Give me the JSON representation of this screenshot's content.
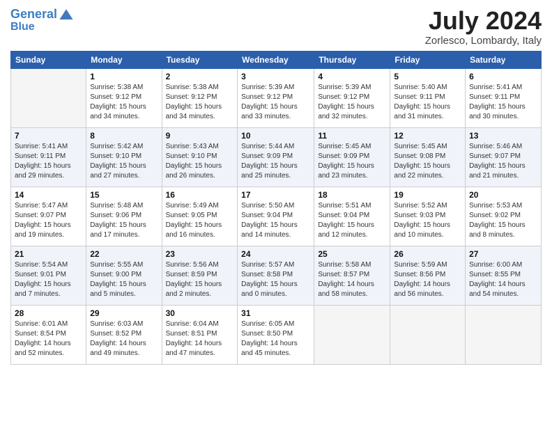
{
  "header": {
    "logo_line1": "General",
    "logo_line2": "Blue",
    "month_title": "July 2024",
    "location": "Zorlesco, Lombardy, Italy"
  },
  "weekdays": [
    "Sunday",
    "Monday",
    "Tuesday",
    "Wednesday",
    "Thursday",
    "Friday",
    "Saturday"
  ],
  "weeks": [
    [
      {
        "day": null,
        "sunrise": null,
        "sunset": null,
        "daylight": null
      },
      {
        "day": "1",
        "sunrise": "5:38 AM",
        "sunset": "9:12 PM",
        "daylight": "15 hours and 34 minutes."
      },
      {
        "day": "2",
        "sunrise": "5:38 AM",
        "sunset": "9:12 PM",
        "daylight": "15 hours and 34 minutes."
      },
      {
        "day": "3",
        "sunrise": "5:39 AM",
        "sunset": "9:12 PM",
        "daylight": "15 hours and 33 minutes."
      },
      {
        "day": "4",
        "sunrise": "5:39 AM",
        "sunset": "9:12 PM",
        "daylight": "15 hours and 32 minutes."
      },
      {
        "day": "5",
        "sunrise": "5:40 AM",
        "sunset": "9:11 PM",
        "daylight": "15 hours and 31 minutes."
      },
      {
        "day": "6",
        "sunrise": "5:41 AM",
        "sunset": "9:11 PM",
        "daylight": "15 hours and 30 minutes."
      }
    ],
    [
      {
        "day": "7",
        "sunrise": "5:41 AM",
        "sunset": "9:11 PM",
        "daylight": "15 hours and 29 minutes."
      },
      {
        "day": "8",
        "sunrise": "5:42 AM",
        "sunset": "9:10 PM",
        "daylight": "15 hours and 27 minutes."
      },
      {
        "day": "9",
        "sunrise": "5:43 AM",
        "sunset": "9:10 PM",
        "daylight": "15 hours and 26 minutes."
      },
      {
        "day": "10",
        "sunrise": "5:44 AM",
        "sunset": "9:09 PM",
        "daylight": "15 hours and 25 minutes."
      },
      {
        "day": "11",
        "sunrise": "5:45 AM",
        "sunset": "9:09 PM",
        "daylight": "15 hours and 23 minutes."
      },
      {
        "day": "12",
        "sunrise": "5:45 AM",
        "sunset": "9:08 PM",
        "daylight": "15 hours and 22 minutes."
      },
      {
        "day": "13",
        "sunrise": "5:46 AM",
        "sunset": "9:07 PM",
        "daylight": "15 hours and 21 minutes."
      }
    ],
    [
      {
        "day": "14",
        "sunrise": "5:47 AM",
        "sunset": "9:07 PM",
        "daylight": "15 hours and 19 minutes."
      },
      {
        "day": "15",
        "sunrise": "5:48 AM",
        "sunset": "9:06 PM",
        "daylight": "15 hours and 17 minutes."
      },
      {
        "day": "16",
        "sunrise": "5:49 AM",
        "sunset": "9:05 PM",
        "daylight": "15 hours and 16 minutes."
      },
      {
        "day": "17",
        "sunrise": "5:50 AM",
        "sunset": "9:04 PM",
        "daylight": "15 hours and 14 minutes."
      },
      {
        "day": "18",
        "sunrise": "5:51 AM",
        "sunset": "9:04 PM",
        "daylight": "15 hours and 12 minutes."
      },
      {
        "day": "19",
        "sunrise": "5:52 AM",
        "sunset": "9:03 PM",
        "daylight": "15 hours and 10 minutes."
      },
      {
        "day": "20",
        "sunrise": "5:53 AM",
        "sunset": "9:02 PM",
        "daylight": "15 hours and 8 minutes."
      }
    ],
    [
      {
        "day": "21",
        "sunrise": "5:54 AM",
        "sunset": "9:01 PM",
        "daylight": "15 hours and 7 minutes."
      },
      {
        "day": "22",
        "sunrise": "5:55 AM",
        "sunset": "9:00 PM",
        "daylight": "15 hours and 5 minutes."
      },
      {
        "day": "23",
        "sunrise": "5:56 AM",
        "sunset": "8:59 PM",
        "daylight": "15 hours and 2 minutes."
      },
      {
        "day": "24",
        "sunrise": "5:57 AM",
        "sunset": "8:58 PM",
        "daylight": "15 hours and 0 minutes."
      },
      {
        "day": "25",
        "sunrise": "5:58 AM",
        "sunset": "8:57 PM",
        "daylight": "14 hours and 58 minutes."
      },
      {
        "day": "26",
        "sunrise": "5:59 AM",
        "sunset": "8:56 PM",
        "daylight": "14 hours and 56 minutes."
      },
      {
        "day": "27",
        "sunrise": "6:00 AM",
        "sunset": "8:55 PM",
        "daylight": "14 hours and 54 minutes."
      }
    ],
    [
      {
        "day": "28",
        "sunrise": "6:01 AM",
        "sunset": "8:54 PM",
        "daylight": "14 hours and 52 minutes."
      },
      {
        "day": "29",
        "sunrise": "6:03 AM",
        "sunset": "8:52 PM",
        "daylight": "14 hours and 49 minutes."
      },
      {
        "day": "30",
        "sunrise": "6:04 AM",
        "sunset": "8:51 PM",
        "daylight": "14 hours and 47 minutes."
      },
      {
        "day": "31",
        "sunrise": "6:05 AM",
        "sunset": "8:50 PM",
        "daylight": "14 hours and 45 minutes."
      },
      {
        "day": null,
        "sunrise": null,
        "sunset": null,
        "daylight": null
      },
      {
        "day": null,
        "sunrise": null,
        "sunset": null,
        "daylight": null
      },
      {
        "day": null,
        "sunrise": null,
        "sunset": null,
        "daylight": null
      }
    ]
  ]
}
